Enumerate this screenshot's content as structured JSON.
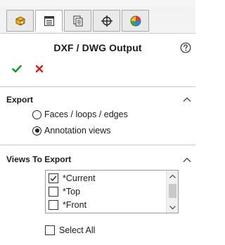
{
  "tabs": [
    {
      "icon": "feature-manager-icon",
      "active": false
    },
    {
      "icon": "property-manager-icon",
      "active": true
    },
    {
      "icon": "configuration-manager-icon",
      "active": false
    },
    {
      "icon": "dimxpert-manager-icon",
      "active": false
    },
    {
      "icon": "display-manager-icon",
      "active": false
    }
  ],
  "panel": {
    "title": "DXF / DWG Output",
    "help_icon": "help-icon",
    "ok_icon": "checkmark-icon",
    "cancel_icon": "x-icon"
  },
  "export": {
    "title": "Export",
    "options": [
      {
        "label": "Faces / loops / edges",
        "selected": false
      },
      {
        "label": "Annotation views",
        "selected": true
      }
    ]
  },
  "views": {
    "title": "Views To Export",
    "items": [
      {
        "label": "*Current",
        "checked": true
      },
      {
        "label": "*Top",
        "checked": false
      },
      {
        "label": "*Front",
        "checked": false
      }
    ],
    "select_all_label": "Select All",
    "select_all_checked": false
  },
  "colors": {
    "ok_green": "#1e9a2c",
    "cancel_red": "#d42020",
    "divider": "#c8c8c8"
  }
}
